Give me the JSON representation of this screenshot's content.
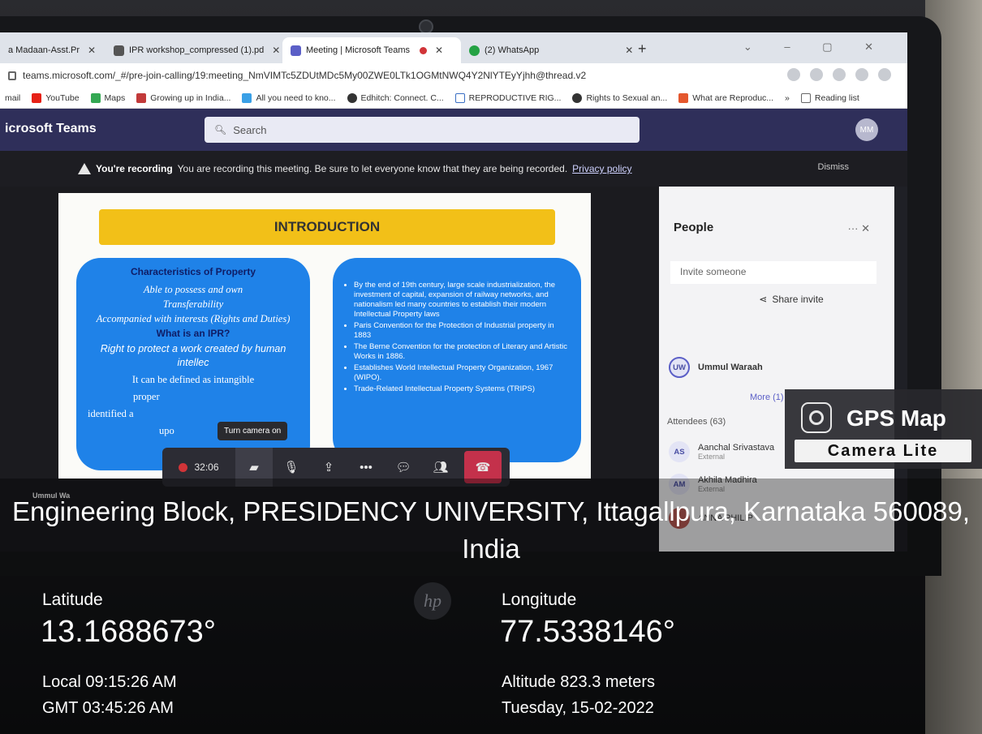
{
  "browser": {
    "tabs": [
      {
        "label": "a Madaan-Asst.Pr"
      },
      {
        "label": "IPR workshop_compressed (1).pd"
      },
      {
        "label": "Meeting | Microsoft Teams"
      },
      {
        "label": "(2) WhatsApp"
      }
    ],
    "url": "teams.microsoft.com/_#/pre-join-calling/19:meeting_NmVIMTc5ZDUtMDc5My00ZWE0LTk1OGMtNWQ4Y2NlYTEyYjhh@thread.v2",
    "bookmarks": [
      "mail",
      "YouTube",
      "Maps",
      "Growing up in India...",
      "All you need to kno...",
      "Edhitch: Connect. C...",
      "REPRODUCTIVE RIG...",
      "Rights to Sexual an...",
      "What are Reproduc...",
      "»",
      "Reading list"
    ]
  },
  "teams": {
    "app_name": "icrosoft Teams",
    "search_placeholder": "Search",
    "avatar": "MM",
    "recording_bold": "You're recording",
    "recording_text": "You are recording this meeting. Be sure to let everyone know that they are being recorded.",
    "privacy_link": "Privacy policy",
    "dismiss": "Dismiss"
  },
  "slide": {
    "title": "INTRODUCTION",
    "left": {
      "heading": "Characteristics of Property",
      "items": [
        "Able to possess and own",
        "Transferability",
        "Accompanied with interests (Rights and Duties)"
      ],
      "question": "What is an IPR?",
      "answer": "Right to protect a work created by human intellec",
      "def1": "It can be defined as intangible",
      "def2": "proper",
      "def3": "identified a",
      "def4": "upo"
    },
    "right": {
      "bullets": [
        "By the end of 19th century, large scale industrialization, the investment of capital, expansion of railway networks, and nationalism led many countries to establish their modern Intellectual Property laws",
        "Paris Convention for the Protection of Industrial property in 1883",
        "The Berne Convention for the protection of Literary and Artistic Works in 1886.",
        "Establishes World Intellectual Property Organization, 1967 (WIPO).",
        "Trade-Related Intellectual Property Systems (TRIPS)"
      ]
    },
    "presenter": "Ummul Wa"
  },
  "callbar": {
    "tooltip": "Turn camera on",
    "timer": "32:06"
  },
  "people": {
    "title": "People",
    "invite_placeholder": "Invite someone",
    "share_invite": "Share invite",
    "organizer": {
      "initials": "UW",
      "name": "Ummul Waraah"
    },
    "more": "More (1)",
    "attendees_label": "Attendees (63)",
    "attendees": [
      {
        "initials": "AS",
        "name": "Aanchal Srivastava",
        "sub": "External"
      },
      {
        "initials": "AM",
        "name": "Akhila Madhira",
        "sub": "External"
      },
      {
        "initials": "",
        "name": "ANNA PHILIP",
        "sub": ""
      }
    ]
  },
  "gps_badge": {
    "name": "GPS Map",
    "sub": "Camera Lite"
  },
  "location": {
    "address": "Engineering Block, PRESIDENCY UNIVERSITY, Ittagallpura, Karnataka 560089, India",
    "latitude_label": "Latitude",
    "latitude": "13.1688673°",
    "longitude_label": "Longitude",
    "longitude": "77.5338146°",
    "local_time": "Local 09:15:26 AM",
    "gmt_time": "GMT 03:45:26 AM",
    "altitude": "Altitude 823.3 meters",
    "date": "Tuesday, 15-02-2022"
  },
  "colors": {
    "teams_purple": "#2f2f5a",
    "slide_blue": "#1f82e8",
    "slide_yellow": "#f2c018",
    "hangup_red": "#c4314b"
  }
}
